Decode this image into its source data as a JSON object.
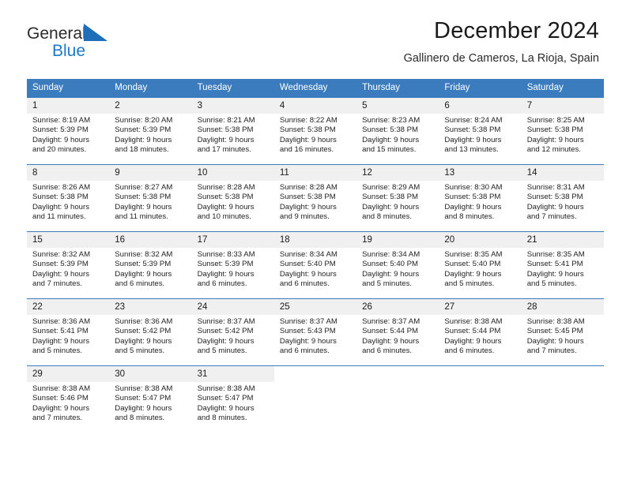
{
  "brand": {
    "name_top": "General",
    "name_bottom": "Blue",
    "triangle_color": "#1e78c8",
    "text_color": "#2b2b2b"
  },
  "header": {
    "title": "December 2024",
    "subtitle": "Gallinero de Cameros, La Rioja, Spain"
  },
  "theme": {
    "header_blue": "#3a7cbe",
    "daynum_bg": "#f0f0f0",
    "page_bg": "#ffffff"
  },
  "weekday_headers": [
    "Sunday",
    "Monday",
    "Tuesday",
    "Wednesday",
    "Thursday",
    "Friday",
    "Saturday"
  ],
  "weeks": [
    [
      {
        "day": "1",
        "sunrise": "Sunrise: 8:19 AM",
        "sunset": "Sunset: 5:39 PM",
        "daylight_1": "Daylight: 9 hours",
        "daylight_2": "and 20 minutes."
      },
      {
        "day": "2",
        "sunrise": "Sunrise: 8:20 AM",
        "sunset": "Sunset: 5:39 PM",
        "daylight_1": "Daylight: 9 hours",
        "daylight_2": "and 18 minutes."
      },
      {
        "day": "3",
        "sunrise": "Sunrise: 8:21 AM",
        "sunset": "Sunset: 5:38 PM",
        "daylight_1": "Daylight: 9 hours",
        "daylight_2": "and 17 minutes."
      },
      {
        "day": "4",
        "sunrise": "Sunrise: 8:22 AM",
        "sunset": "Sunset: 5:38 PM",
        "daylight_1": "Daylight: 9 hours",
        "daylight_2": "and 16 minutes."
      },
      {
        "day": "5",
        "sunrise": "Sunrise: 8:23 AM",
        "sunset": "Sunset: 5:38 PM",
        "daylight_1": "Daylight: 9 hours",
        "daylight_2": "and 15 minutes."
      },
      {
        "day": "6",
        "sunrise": "Sunrise: 8:24 AM",
        "sunset": "Sunset: 5:38 PM",
        "daylight_1": "Daylight: 9 hours",
        "daylight_2": "and 13 minutes."
      },
      {
        "day": "7",
        "sunrise": "Sunrise: 8:25 AM",
        "sunset": "Sunset: 5:38 PM",
        "daylight_1": "Daylight: 9 hours",
        "daylight_2": "and 12 minutes."
      }
    ],
    [
      {
        "day": "8",
        "sunrise": "Sunrise: 8:26 AM",
        "sunset": "Sunset: 5:38 PM",
        "daylight_1": "Daylight: 9 hours",
        "daylight_2": "and 11 minutes."
      },
      {
        "day": "9",
        "sunrise": "Sunrise: 8:27 AM",
        "sunset": "Sunset: 5:38 PM",
        "daylight_1": "Daylight: 9 hours",
        "daylight_2": "and 11 minutes."
      },
      {
        "day": "10",
        "sunrise": "Sunrise: 8:28 AM",
        "sunset": "Sunset: 5:38 PM",
        "daylight_1": "Daylight: 9 hours",
        "daylight_2": "and 10 minutes."
      },
      {
        "day": "11",
        "sunrise": "Sunrise: 8:28 AM",
        "sunset": "Sunset: 5:38 PM",
        "daylight_1": "Daylight: 9 hours",
        "daylight_2": "and 9 minutes."
      },
      {
        "day": "12",
        "sunrise": "Sunrise: 8:29 AM",
        "sunset": "Sunset: 5:38 PM",
        "daylight_1": "Daylight: 9 hours",
        "daylight_2": "and 8 minutes."
      },
      {
        "day": "13",
        "sunrise": "Sunrise: 8:30 AM",
        "sunset": "Sunset: 5:38 PM",
        "daylight_1": "Daylight: 9 hours",
        "daylight_2": "and 8 minutes."
      },
      {
        "day": "14",
        "sunrise": "Sunrise: 8:31 AM",
        "sunset": "Sunset: 5:38 PM",
        "daylight_1": "Daylight: 9 hours",
        "daylight_2": "and 7 minutes."
      }
    ],
    [
      {
        "day": "15",
        "sunrise": "Sunrise: 8:32 AM",
        "sunset": "Sunset: 5:39 PM",
        "daylight_1": "Daylight: 9 hours",
        "daylight_2": "and 7 minutes."
      },
      {
        "day": "16",
        "sunrise": "Sunrise: 8:32 AM",
        "sunset": "Sunset: 5:39 PM",
        "daylight_1": "Daylight: 9 hours",
        "daylight_2": "and 6 minutes."
      },
      {
        "day": "17",
        "sunrise": "Sunrise: 8:33 AM",
        "sunset": "Sunset: 5:39 PM",
        "daylight_1": "Daylight: 9 hours",
        "daylight_2": "and 6 minutes."
      },
      {
        "day": "18",
        "sunrise": "Sunrise: 8:34 AM",
        "sunset": "Sunset: 5:40 PM",
        "daylight_1": "Daylight: 9 hours",
        "daylight_2": "and 6 minutes."
      },
      {
        "day": "19",
        "sunrise": "Sunrise: 8:34 AM",
        "sunset": "Sunset: 5:40 PM",
        "daylight_1": "Daylight: 9 hours",
        "daylight_2": "and 5 minutes."
      },
      {
        "day": "20",
        "sunrise": "Sunrise: 8:35 AM",
        "sunset": "Sunset: 5:40 PM",
        "daylight_1": "Daylight: 9 hours",
        "daylight_2": "and 5 minutes."
      },
      {
        "day": "21",
        "sunrise": "Sunrise: 8:35 AM",
        "sunset": "Sunset: 5:41 PM",
        "daylight_1": "Daylight: 9 hours",
        "daylight_2": "and 5 minutes."
      }
    ],
    [
      {
        "day": "22",
        "sunrise": "Sunrise: 8:36 AM",
        "sunset": "Sunset: 5:41 PM",
        "daylight_1": "Daylight: 9 hours",
        "daylight_2": "and 5 minutes."
      },
      {
        "day": "23",
        "sunrise": "Sunrise: 8:36 AM",
        "sunset": "Sunset: 5:42 PM",
        "daylight_1": "Daylight: 9 hours",
        "daylight_2": "and 5 minutes."
      },
      {
        "day": "24",
        "sunrise": "Sunrise: 8:37 AM",
        "sunset": "Sunset: 5:42 PM",
        "daylight_1": "Daylight: 9 hours",
        "daylight_2": "and 5 minutes."
      },
      {
        "day": "25",
        "sunrise": "Sunrise: 8:37 AM",
        "sunset": "Sunset: 5:43 PM",
        "daylight_1": "Daylight: 9 hours",
        "daylight_2": "and 6 minutes."
      },
      {
        "day": "26",
        "sunrise": "Sunrise: 8:37 AM",
        "sunset": "Sunset: 5:44 PM",
        "daylight_1": "Daylight: 9 hours",
        "daylight_2": "and 6 minutes."
      },
      {
        "day": "27",
        "sunrise": "Sunrise: 8:38 AM",
        "sunset": "Sunset: 5:44 PM",
        "daylight_1": "Daylight: 9 hours",
        "daylight_2": "and 6 minutes."
      },
      {
        "day": "28",
        "sunrise": "Sunrise: 8:38 AM",
        "sunset": "Sunset: 5:45 PM",
        "daylight_1": "Daylight: 9 hours",
        "daylight_2": "and 7 minutes."
      }
    ],
    [
      {
        "day": "29",
        "sunrise": "Sunrise: 8:38 AM",
        "sunset": "Sunset: 5:46 PM",
        "daylight_1": "Daylight: 9 hours",
        "daylight_2": "and 7 minutes."
      },
      {
        "day": "30",
        "sunrise": "Sunrise: 8:38 AM",
        "sunset": "Sunset: 5:47 PM",
        "daylight_1": "Daylight: 9 hours",
        "daylight_2": "and 8 minutes."
      },
      {
        "day": "31",
        "sunrise": "Sunrise: 8:38 AM",
        "sunset": "Sunset: 5:47 PM",
        "daylight_1": "Daylight: 9 hours",
        "daylight_2": "and 8 minutes."
      },
      null,
      null,
      null,
      null
    ]
  ]
}
